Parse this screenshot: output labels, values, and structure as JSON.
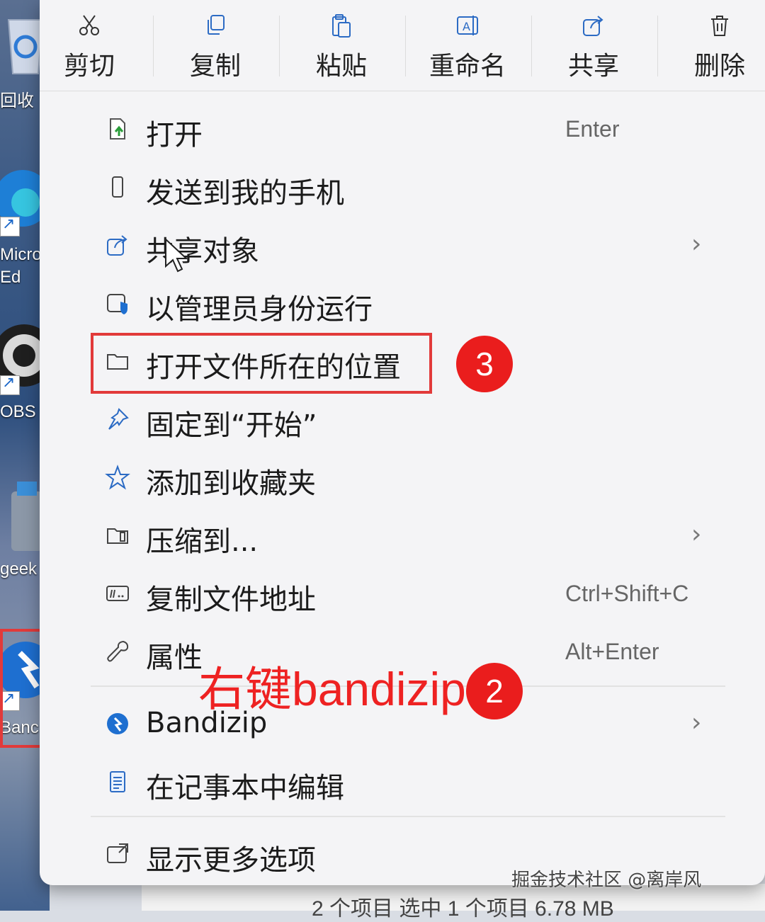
{
  "desktop": {
    "icons": [
      {
        "name": "recycle-bin",
        "label": "回收"
      },
      {
        "name": "microsoft-edge",
        "label": "Micro\nEd"
      },
      {
        "name": "obs-studio",
        "label": "OBS S"
      },
      {
        "name": "geek-uninstaller",
        "label": "geek"
      },
      {
        "name": "bandizip",
        "label": "Banc"
      }
    ]
  },
  "toolbar": {
    "cut": "剪切",
    "copy": "复制",
    "paste": "粘贴",
    "rename": "重命名",
    "share": "共享",
    "delete": "删除"
  },
  "menu": {
    "items": [
      {
        "label": "打开",
        "shortcut": "Enter",
        "icon": "open-file-icon"
      },
      {
        "label": "发送到我的手机",
        "shortcut": "",
        "icon": "phone-icon"
      },
      {
        "label": "共享对象",
        "shortcut": "",
        "icon": "share-icon",
        "submenu": true
      },
      {
        "label": "以管理员身份运行",
        "shortcut": "",
        "icon": "admin-shield-icon"
      },
      {
        "label": "打开文件所在的位置",
        "shortcut": "",
        "icon": "folder-icon"
      },
      {
        "label": "固定到“开始”",
        "shortcut": "",
        "icon": "pin-icon"
      },
      {
        "label": "添加到收藏夹",
        "shortcut": "",
        "icon": "star-icon"
      },
      {
        "label": "压缩到...",
        "shortcut": "",
        "icon": "compress-icon",
        "submenu": true
      },
      {
        "label": "复制文件地址",
        "shortcut": "Ctrl+Shift+C",
        "icon": "path-icon"
      },
      {
        "label": "属性",
        "shortcut": "Alt+Enter",
        "icon": "wrench-icon"
      },
      {
        "label": "Bandizip",
        "shortcut": "",
        "icon": "bandizip-icon",
        "submenu": true
      },
      {
        "label": "在记事本中编辑",
        "shortcut": "",
        "icon": "notepad-icon"
      },
      {
        "label": "显示更多选项",
        "shortcut": "",
        "icon": "more-options-icon"
      }
    ],
    "chevron": "›"
  },
  "annotations": {
    "step2_text": "右键bandizip",
    "step2_badge": "2",
    "step3_badge": "3",
    "highlight_color": "#e23a3a"
  },
  "statusbar": {
    "text": "2 个项目   选中 1 个项目  6.78 MB"
  },
  "watermark": {
    "text": "掘金技术社区 @离岸风"
  }
}
